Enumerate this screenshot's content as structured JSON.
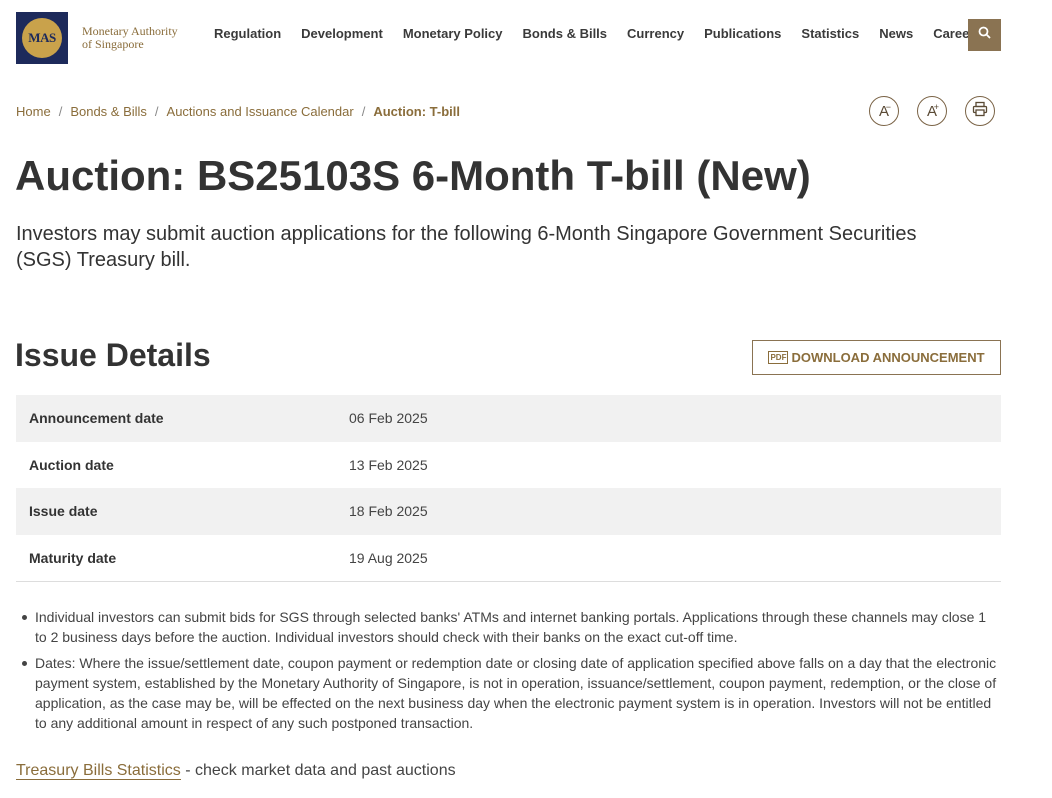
{
  "brand": {
    "logo_text": "MAS",
    "name_line1": "Monetary Authority",
    "name_line2": "of Singapore"
  },
  "nav": {
    "items": [
      {
        "label": "Regulation"
      },
      {
        "label": "Development"
      },
      {
        "label": "Monetary Policy"
      },
      {
        "label": "Bonds & Bills"
      },
      {
        "label": "Currency"
      },
      {
        "label": "Publications"
      },
      {
        "label": "Statistics"
      },
      {
        "label": "News"
      },
      {
        "label": "Careers"
      }
    ],
    "search_icon": "search-icon"
  },
  "breadcrumb": {
    "items": [
      {
        "label": "Home"
      },
      {
        "label": "Bonds & Bills"
      },
      {
        "label": "Auctions and Issuance Calendar"
      }
    ],
    "current": "Auction: T-bill",
    "separator": "/"
  },
  "tools": {
    "decrease_label": "A",
    "decrease_sup": "−",
    "increase_label": "A",
    "increase_sup": "+",
    "print_icon": "print-icon"
  },
  "page": {
    "title": "Auction: BS25103S 6-Month T-bill (New)",
    "lede": "Investors may submit auction applications for the following 6-Month Singapore Government Securities (SGS) Treasury bill."
  },
  "issue_details": {
    "heading": "Issue Details",
    "download_label": "DOWNLOAD ANNOUNCEMENT",
    "download_icon_text": "PDF",
    "rows": [
      {
        "label": "Announcement date",
        "value": "06 Feb 2025"
      },
      {
        "label": "Auction date",
        "value": "13 Feb 2025"
      },
      {
        "label": "Issue date",
        "value": "18 Feb 2025"
      },
      {
        "label": "Maturity date",
        "value": "19 Aug 2025"
      }
    ]
  },
  "notes": [
    "Individual investors can submit bids for SGS through selected banks' ATMs and internet banking portals. Applications through these channels may close 1 to 2 business days before the auction. Individual investors should check with their banks on the exact cut-off time.",
    "Dates: Where the issue/settlement date, coupon payment or redemption date or closing date of application specified above falls on a day that the electronic payment system, established by the Monetary Authority of Singapore, is not in operation, issuance/settlement, coupon payment, redemption, or the close of application, as the case may be, will be effected on the next business day when the electronic payment system is in operation. Investors will not be entitled to any additional amount in respect of any such postponed transaction."
  ],
  "footer": {
    "link_text": "Treasury Bills Statistics",
    "suffix": " - check market data and past auctions"
  },
  "colors": {
    "accent": "#8a6d3b",
    "button_bg": "#8a7352",
    "logo_bg": "#1d2a5b",
    "logo_gold": "#c9a24b",
    "row_shade": "#f1f1f1"
  }
}
